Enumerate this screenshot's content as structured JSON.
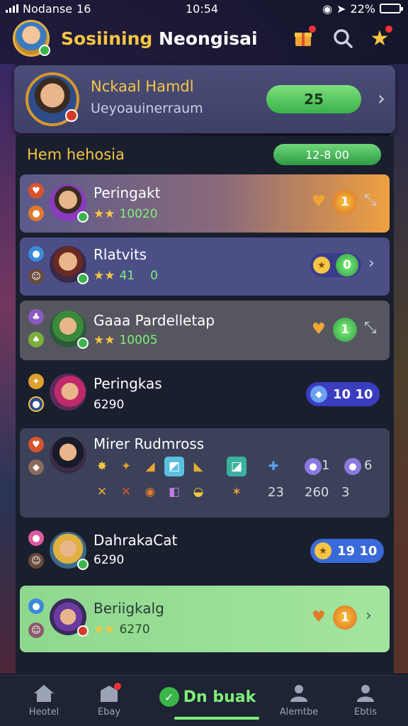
{
  "status": {
    "carrier": "Nodanse",
    "net": "16",
    "time": "10:54",
    "battery": "22%"
  },
  "header": {
    "title_part1": "Sosiining",
    "title_part2": "Neongisai"
  },
  "profile": {
    "name": "Nckaal Hamdl",
    "subtitle": "Ueyoauinerraum",
    "score": "25"
  },
  "section": {
    "title": "Hem hehosia",
    "pill": "12-8 00"
  },
  "rows": [
    {
      "name": "Peringakt",
      "sub": "10020",
      "action": "1"
    },
    {
      "name": "Rlatvits",
      "sub_a": "41",
      "sub_b": "0",
      "action": "0"
    },
    {
      "name": "Gaaa Pardelletap",
      "sub": "10005",
      "action": "1"
    },
    {
      "name": "Peringkas",
      "sub": "6290",
      "pill": "10 10"
    },
    {
      "name": "Mirer Rudmross",
      "nums_top": [
        "1",
        "6"
      ],
      "nums_bottom": [
        "23",
        "260",
        "3"
      ]
    },
    {
      "name": "DahrakaCat",
      "sub": "6290",
      "pill": "19 10"
    },
    {
      "name": "Beriigkalg",
      "sub": "6270",
      "action": "1"
    }
  ],
  "nav": {
    "home": "Heotel",
    "shop": "Ebay",
    "center": "Dn buak",
    "members": "Alemtbe",
    "extra": "Ebtis"
  },
  "colors": {
    "accent_gold": "#f6c544",
    "accent_green": "#38b24a",
    "panel": "#1a1f2e"
  }
}
